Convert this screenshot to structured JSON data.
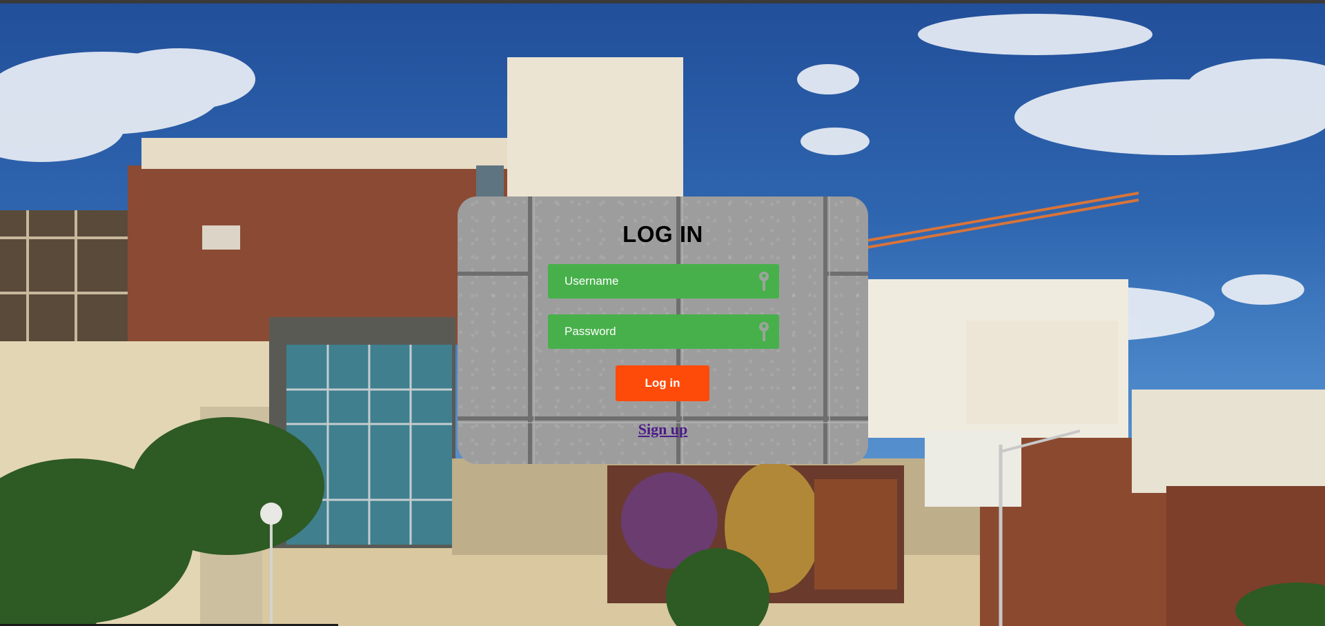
{
  "login": {
    "title": "LOG IN",
    "username_placeholder": "Username",
    "password_placeholder": "Password",
    "submit_label": "Log in",
    "signup_label": "Sign up",
    "field_icon": "key-icon"
  },
  "colors": {
    "field_green": "#47b04b",
    "button_orange": "#ff4b0a",
    "card_gray": "#9d9d9d",
    "link_purple": "#4b1a8a"
  },
  "background": {
    "icon": "campus-building-photo"
  }
}
